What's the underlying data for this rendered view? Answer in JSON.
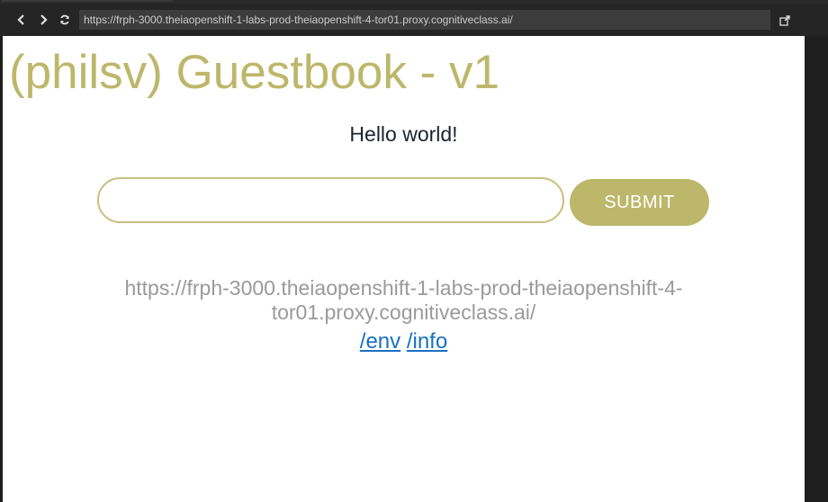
{
  "browser": {
    "url": "https://frph-3000.theiaopenshift-1-labs-prod-theiaopenshift-4-tor01.proxy.cognitiveclass.ai/",
    "back_icon": "chevron-left-icon",
    "forward_icon": "chevron-right-icon",
    "reload_icon": "refresh-icon",
    "open_external_icon": "external-link-icon"
  },
  "page": {
    "title": "(philsv) Guestbook - v1",
    "greeting": "Hello world!",
    "entry_input_value": "",
    "submit_label": "SUBMIT",
    "host_url": "https://frph-3000.theiaopenshift-1-labs-prod-theiaopenshift-4-tor01.proxy.cognitiveclass.ai/",
    "links": {
      "env": "/env",
      "info": "/info"
    }
  },
  "colors": {
    "accent": "#bdb76b",
    "input_border": "#c9be7d",
    "link": "#1a6fc2",
    "muted_text": "#9a9a9a"
  }
}
